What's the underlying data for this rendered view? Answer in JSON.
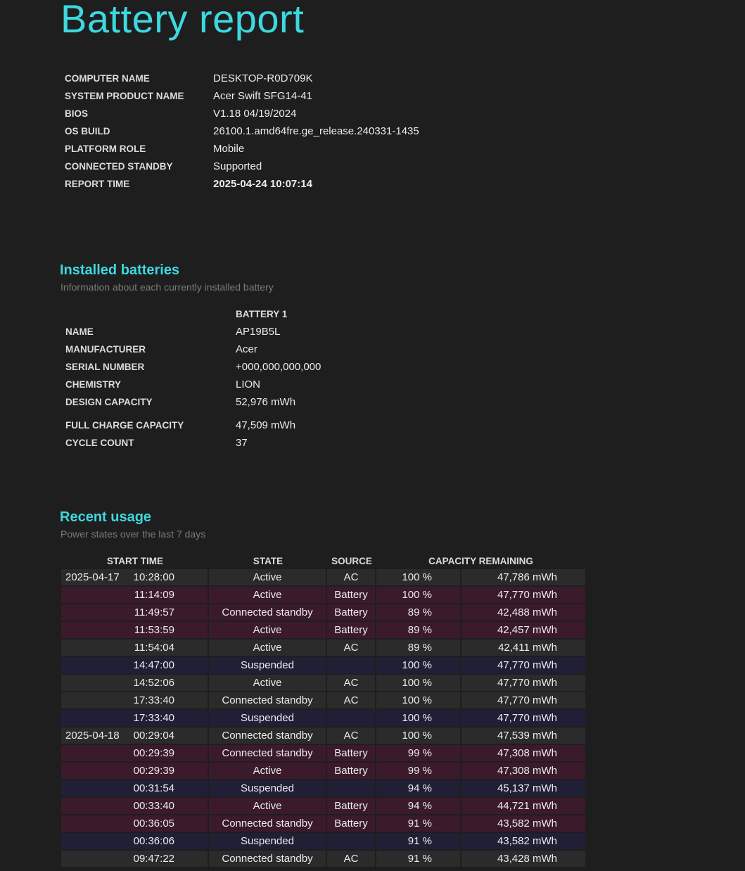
{
  "title": "Battery report",
  "system_info": [
    {
      "label": "COMPUTER NAME",
      "value": "DESKTOP-R0D709K"
    },
    {
      "label": "SYSTEM PRODUCT NAME",
      "value": "Acer Swift SFG14-41"
    },
    {
      "label": "BIOS",
      "value": "V1.18 04/19/2024"
    },
    {
      "label": "OS BUILD",
      "value": "26100.1.amd64fre.ge_release.240331-1435"
    },
    {
      "label": "PLATFORM ROLE",
      "value": "Mobile"
    },
    {
      "label": "CONNECTED STANDBY",
      "value": "Supported"
    },
    {
      "label": "REPORT TIME",
      "value": "2025-04-24  10:07:14"
    }
  ],
  "installed_batteries": {
    "title": "Installed batteries",
    "subtitle": "Information about each currently installed battery",
    "column_header": "BATTERY 1",
    "rows": [
      {
        "label": "NAME",
        "value": "AP19B5L"
      },
      {
        "label": "MANUFACTURER",
        "value": "Acer"
      },
      {
        "label": "SERIAL NUMBER",
        "value": "+000,000,000,000"
      },
      {
        "label": "CHEMISTRY",
        "value": "LION"
      },
      {
        "label": "DESIGN CAPACITY",
        "value": "52,976 mWh"
      },
      {
        "label": "FULL CHARGE CAPACITY",
        "value": "47,509 mWh"
      },
      {
        "label": "CYCLE COUNT",
        "value": "37"
      }
    ]
  },
  "recent_usage": {
    "title": "Recent usage",
    "subtitle": "Power states over the last 7 days",
    "headers": {
      "start_time": "START TIME",
      "state": "STATE",
      "source": "SOURCE",
      "capacity": "CAPACITY REMAINING"
    },
    "rows": [
      {
        "date": "2025-04-17",
        "time": "10:28:00",
        "state": "Active",
        "source": "AC",
        "percent": "100 %",
        "mwh": "47,786 mWh",
        "kind": "ac"
      },
      {
        "date": "",
        "time": "11:14:09",
        "state": "Active",
        "source": "Battery",
        "percent": "100 %",
        "mwh": "47,770 mWh",
        "kind": "battery"
      },
      {
        "date": "",
        "time": "11:49:57",
        "state": "Connected standby",
        "source": "Battery",
        "percent": "89 %",
        "mwh": "42,488 mWh",
        "kind": "battery"
      },
      {
        "date": "",
        "time": "11:53:59",
        "state": "Active",
        "source": "Battery",
        "percent": "89 %",
        "mwh": "42,457 mWh",
        "kind": "battery"
      },
      {
        "date": "",
        "time": "11:54:04",
        "state": "Active",
        "source": "AC",
        "percent": "89 %",
        "mwh": "42,411 mWh",
        "kind": "ac"
      },
      {
        "date": "",
        "time": "14:47:00",
        "state": "Suspended",
        "source": "",
        "percent": "100 %",
        "mwh": "47,770 mWh",
        "kind": "suspended"
      },
      {
        "date": "",
        "time": "14:52:06",
        "state": "Active",
        "source": "AC",
        "percent": "100 %",
        "mwh": "47,770 mWh",
        "kind": "ac"
      },
      {
        "date": "",
        "time": "17:33:40",
        "state": "Connected standby",
        "source": "AC",
        "percent": "100 %",
        "mwh": "47,770 mWh",
        "kind": "ac"
      },
      {
        "date": "",
        "time": "17:33:40",
        "state": "Suspended",
        "source": "",
        "percent": "100 %",
        "mwh": "47,770 mWh",
        "kind": "suspended"
      },
      {
        "date": "2025-04-18",
        "time": "00:29:04",
        "state": "Connected standby",
        "source": "AC",
        "percent": "100 %",
        "mwh": "47,539 mWh",
        "kind": "ac"
      },
      {
        "date": "",
        "time": "00:29:39",
        "state": "Connected standby",
        "source": "Battery",
        "percent": "99 %",
        "mwh": "47,308 mWh",
        "kind": "battery"
      },
      {
        "date": "",
        "time": "00:29:39",
        "state": "Active",
        "source": "Battery",
        "percent": "99 %",
        "mwh": "47,308 mWh",
        "kind": "battery"
      },
      {
        "date": "",
        "time": "00:31:54",
        "state": "Suspended",
        "source": "",
        "percent": "94 %",
        "mwh": "45,137 mWh",
        "kind": "suspended"
      },
      {
        "date": "",
        "time": "00:33:40",
        "state": "Active",
        "source": "Battery",
        "percent": "94 %",
        "mwh": "44,721 mWh",
        "kind": "battery"
      },
      {
        "date": "",
        "time": "00:36:05",
        "state": "Connected standby",
        "source": "Battery",
        "percent": "91 %",
        "mwh": "43,582 mWh",
        "kind": "battery"
      },
      {
        "date": "",
        "time": "00:36:06",
        "state": "Suspended",
        "source": "",
        "percent": "91 %",
        "mwh": "43,582 mWh",
        "kind": "suspended"
      },
      {
        "date": "",
        "time": "09:47:22",
        "state": "Connected standby",
        "source": "AC",
        "percent": "91 %",
        "mwh": "43,428 mWh",
        "kind": "ac"
      }
    ]
  }
}
